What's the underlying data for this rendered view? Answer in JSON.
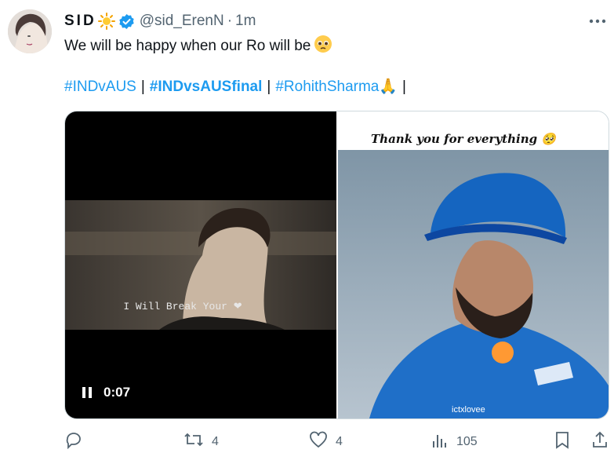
{
  "tweet": {
    "display_name": "SID",
    "handle": "@sid_ErenN",
    "separator": "·",
    "time": "1m",
    "text": "We will be happy when our Ro will be",
    "hashtags": [
      {
        "text": "#INDvAUS",
        "bold": false
      },
      {
        "text": "#INDvsAUSfinal",
        "bold": true
      },
      {
        "text": "#RohithSharma🙏",
        "bold": false
      }
    ],
    "tag_separator": "|"
  },
  "media": {
    "video": {
      "caption": "I Will Break Your ❤",
      "time": "0:07"
    },
    "photo": {
      "title": "Thank you for everything 🥺",
      "watermark": "ictxlovee"
    }
  },
  "actions": {
    "reply": "",
    "retweet": "4",
    "like": "4",
    "views": "105"
  },
  "icons": [
    "sun-emoji-icon",
    "verified-badge-icon",
    "more-icon",
    "pleading-face-icon",
    "pause-icon",
    "reply-icon",
    "retweet-icon",
    "like-icon",
    "views-icon",
    "bookmark-icon",
    "share-icon"
  ],
  "colors": {
    "accent": "#1d9bf0",
    "secondary_text": "#536471",
    "border": "#cfd9de"
  }
}
